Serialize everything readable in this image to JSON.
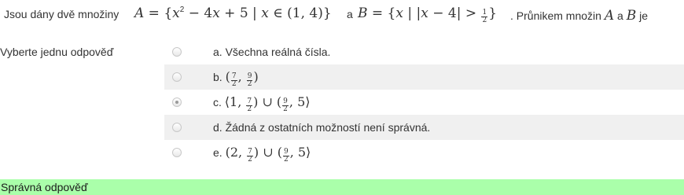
{
  "question": {
    "intro": "Jsou dány dvě množiny",
    "set_a_name": "A",
    "and_word": "a",
    "set_b_name": "B",
    "outro": ". Průnikem množin",
    "outro_a": "A",
    "outro_and": "a",
    "outro_b": "B",
    "outro_end": "je"
  },
  "prompt": "Vyberte jednu odpověď",
  "answers": [
    {
      "letter": "a.",
      "text": "Všechna reálná čísla.",
      "selected": false
    },
    {
      "letter": "b.",
      "math": "(7/2, 9/2)",
      "selected": false
    },
    {
      "letter": "c.",
      "math": "⟨1, 7/2) ∪ (9/2, 5⟩",
      "selected": true
    },
    {
      "letter": "d.",
      "text": "Žádná z ostatních možností není správná.",
      "selected": false
    },
    {
      "letter": "e.",
      "math": "(2, 7/2) ∪ (9/2, 5⟩",
      "selected": false
    }
  ],
  "feedback": "Správná odpověď",
  "colors": {
    "feedback_bg": "#aaffaa",
    "alt_row_bg": "#f0f0f0"
  }
}
